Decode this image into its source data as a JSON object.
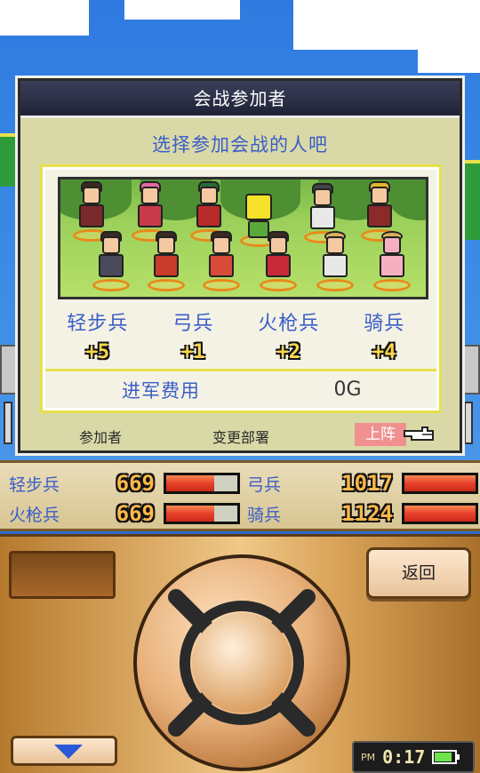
{
  "dialog": {
    "title": "会战参加者",
    "prompt": "选择参加会战的人吧",
    "categories": [
      {
        "name": "轻步兵",
        "bonus": "+5"
      },
      {
        "name": "弓兵",
        "bonus": "+1"
      },
      {
        "name": "火枪兵",
        "bonus": "+2"
      },
      {
        "name": "骑兵",
        "bonus": "+4"
      }
    ],
    "cost_label": "进军费用",
    "cost_value": "0G",
    "footer": {
      "participants": "参加者",
      "change_unit": "变更部署",
      "deploy": "上阵"
    }
  },
  "stats": [
    {
      "name": "轻步兵",
      "value": "669",
      "level": 0.67
    },
    {
      "name": "弓兵",
      "value": "1017",
      "level": 1.0
    },
    {
      "name": "火枪兵",
      "value": "669",
      "level": 0.67
    },
    {
      "name": "骑兵",
      "value": "1124",
      "level": 1.0
    }
  ],
  "controller": {
    "back_label": "返回"
  },
  "clock": {
    "period": "PM",
    "time": "0:17",
    "battery": 0.8
  },
  "colors": {
    "label_blue": "#3a5ec8",
    "bar_red": "#e8402a",
    "deploy_pink": "#f09090"
  }
}
